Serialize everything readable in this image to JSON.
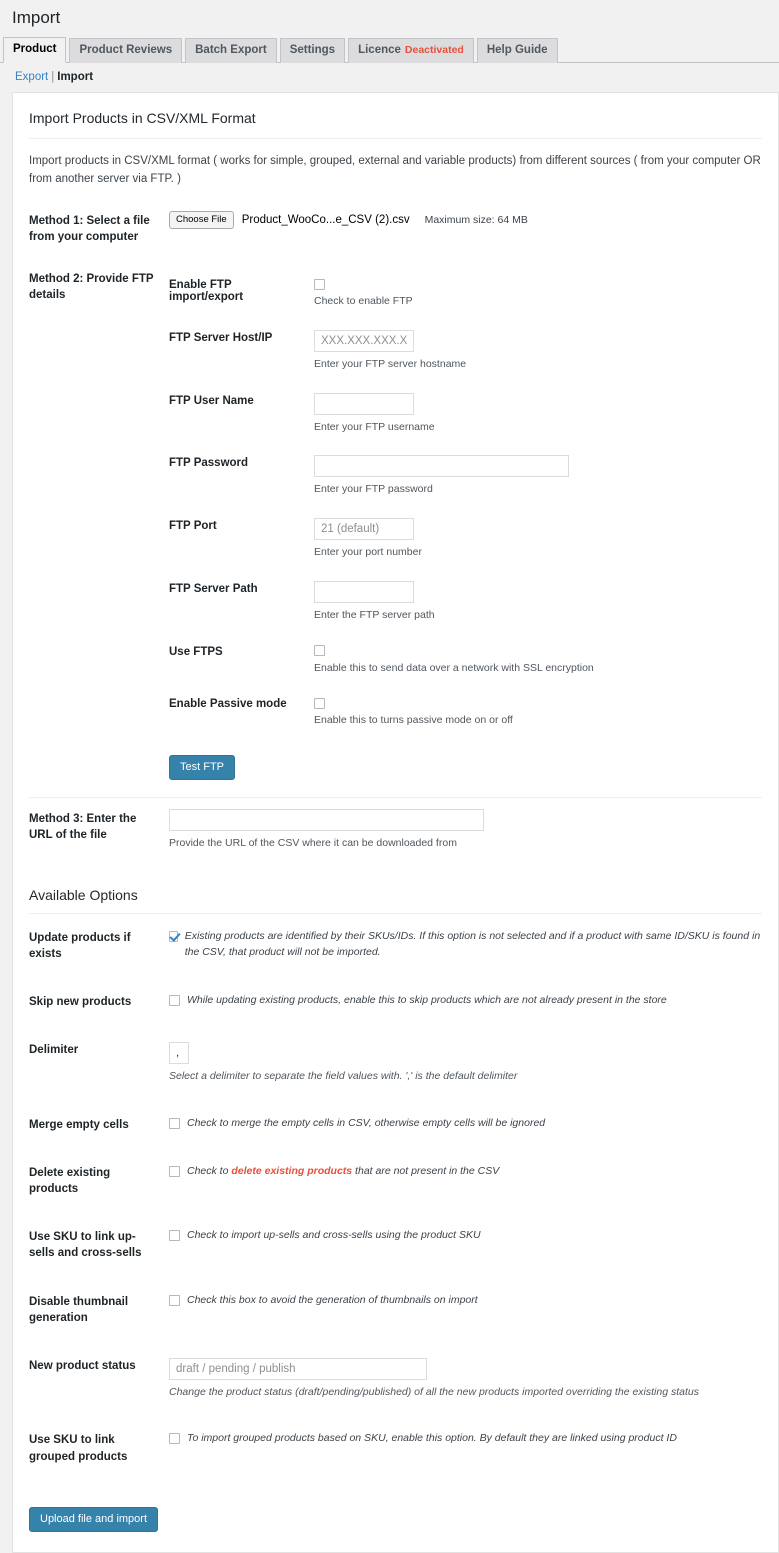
{
  "header": {
    "title": "Import"
  },
  "tabs": [
    {
      "label": "Product",
      "active": true,
      "badge": ""
    },
    {
      "label": "Product Reviews",
      "active": false,
      "badge": ""
    },
    {
      "label": "Batch Export",
      "active": false,
      "badge": ""
    },
    {
      "label": "Settings",
      "active": false,
      "badge": ""
    },
    {
      "label": "Licence",
      "active": false,
      "badge": "Deactivated"
    },
    {
      "label": "Help Guide",
      "active": false,
      "badge": ""
    }
  ],
  "subnav": {
    "export": "Export",
    "separator": "|",
    "import": "Import"
  },
  "panel": {
    "title": "Import Products in CSV/XML Format",
    "intro": "Import products in CSV/XML format ( works for simple, grouped, external and variable products) from different sources ( from your computer OR from another server via FTP. )"
  },
  "method1": {
    "label": "Method 1: Select a file from your computer",
    "choose_file_label": "Choose File",
    "file_name": "Product_WooCo...e_CSV (2).csv",
    "max_size": "Maximum size: 64 MB"
  },
  "method2": {
    "label": "Method 2: Provide FTP details",
    "fields": [
      {
        "label": "Enable FTP import/export",
        "type": "checkbox",
        "checked": false,
        "desc": "Check to enable FTP",
        "placeholder": "",
        "value": ""
      },
      {
        "label": "FTP Server Host/IP",
        "type": "text",
        "checked": false,
        "desc": "Enter your FTP server hostname",
        "placeholder": "XXX.XXX.XXX.XXX",
        "value": ""
      },
      {
        "label": "FTP User Name",
        "type": "text",
        "checked": false,
        "desc": "Enter your FTP username",
        "placeholder": "",
        "value": ""
      },
      {
        "label": "FTP Password",
        "type": "password",
        "checked": false,
        "desc": "Enter your FTP password",
        "placeholder": "",
        "value": ""
      },
      {
        "label": "FTP Port",
        "type": "text",
        "checked": false,
        "desc": "Enter your port number",
        "placeholder": "21 (default)",
        "value": ""
      },
      {
        "label": "FTP Server Path",
        "type": "text",
        "checked": false,
        "desc": "Enter the FTP server path",
        "placeholder": "",
        "value": ""
      },
      {
        "label": "Use FTPS",
        "type": "checkbox",
        "checked": false,
        "desc": "Enable this to send data over a network with SSL encryption",
        "placeholder": "",
        "value": ""
      },
      {
        "label": "Enable Passive mode",
        "type": "checkbox",
        "checked": false,
        "desc": "Enable this to turns passive mode on or off",
        "placeholder": "",
        "value": ""
      }
    ],
    "test_button": "Test FTP"
  },
  "method3": {
    "label": "Method 3: Enter the URL of the file",
    "value": "",
    "placeholder": "",
    "desc": "Provide the URL of the CSV where it can be downloaded from"
  },
  "options": {
    "heading": "Available Options",
    "items": [
      {
        "label": "Update products if exists",
        "type": "checkbox",
        "checked": true,
        "text": "Existing products are identified by their SKUs/IDs. If this option is not selected and if a product with same ID/SKU is found in the CSV, that product will not be imported."
      },
      {
        "label": "Skip new products",
        "type": "checkbox",
        "checked": false,
        "text": "While updating existing products, enable this to skip products which are not already present in the store"
      },
      {
        "label": "Delimiter",
        "type": "text-small",
        "value": ",",
        "text": "Select a delimiter to separate the field values with. ',' is the default delimiter"
      },
      {
        "label": "Merge empty cells",
        "type": "checkbox",
        "checked": false,
        "text": "Check to merge the empty cells in CSV, otherwise empty cells will be ignored"
      },
      {
        "label": "Delete existing products",
        "type": "checkbox-danger",
        "checked": false,
        "text_before": "Check to ",
        "text_danger": "delete existing products",
        "text_after": " that are not present in the CSV"
      },
      {
        "label": "Use SKU to link up-sells and cross-sells",
        "type": "checkbox",
        "checked": false,
        "text": "Check to import up-sells and cross-sells using the product SKU"
      },
      {
        "label": "Disable thumbnail generation",
        "type": "checkbox",
        "checked": false,
        "text": "Check this box to avoid the generation of thumbnails on import"
      },
      {
        "label": "New product status",
        "type": "text-status",
        "value": "",
        "placeholder": "draft / pending / publish",
        "text": "Change the product status (draft/pending/published) of all the new products imported overriding the existing status"
      },
      {
        "label": "Use SKU to link grouped products",
        "type": "checkbox",
        "checked": false,
        "text": "To import grouped products based on SKU, enable this option. By default they are linked using product ID"
      }
    ]
  },
  "submit": {
    "label": "Upload file and import"
  },
  "colors": {
    "accent": "#3582ab",
    "link": "#3582c4",
    "danger": "#e8503a",
    "page_bg": "#f1f1f1",
    "panel_bg": "#ffffff"
  }
}
